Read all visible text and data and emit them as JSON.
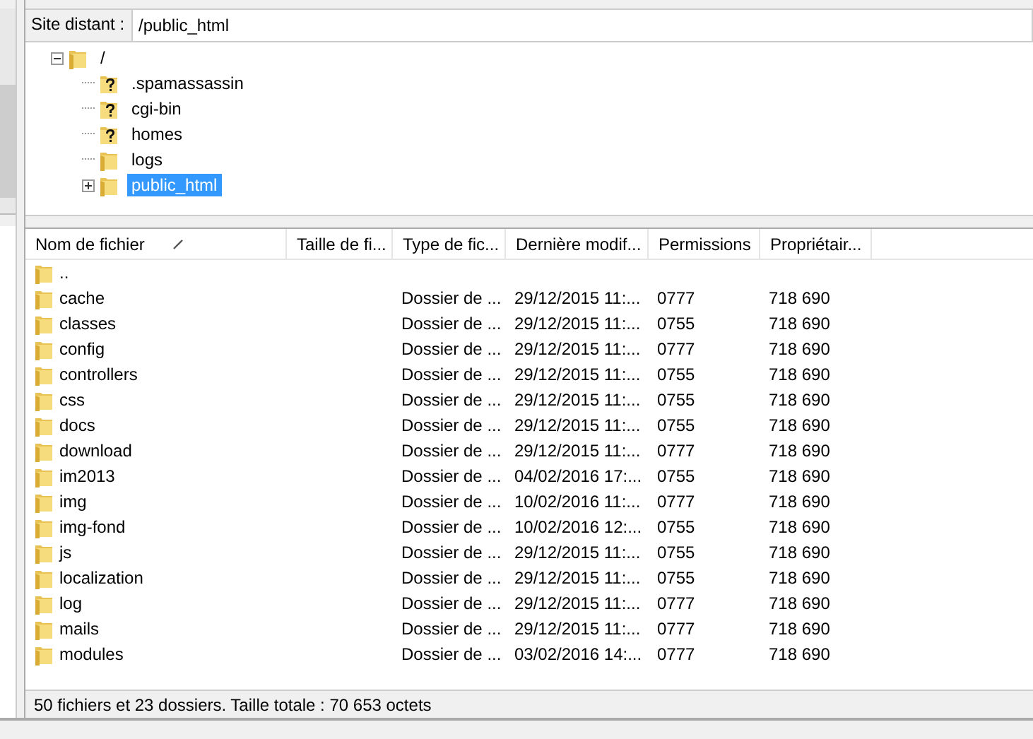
{
  "remote_site": {
    "label": "Site distant :",
    "path": "/public_html"
  },
  "tree": [
    {
      "name": "/",
      "kind": "folder",
      "expanded": true,
      "selected": false,
      "children": [
        {
          "name": ".spamassassin",
          "kind": "unknown",
          "selected": false
        },
        {
          "name": "cgi-bin",
          "kind": "unknown",
          "selected": false
        },
        {
          "name": "homes",
          "kind": "unknown",
          "selected": false
        },
        {
          "name": "logs",
          "kind": "folder",
          "selected": false
        },
        {
          "name": "public_html",
          "kind": "folder",
          "expanded": false,
          "selected": true
        }
      ]
    }
  ],
  "table": {
    "columns": [
      {
        "label": "Nom de fichier",
        "sorted": true
      },
      {
        "label": "Taille de fi...",
        "sorted": false
      },
      {
        "label": "Type de fic...",
        "sorted": false
      },
      {
        "label": "Dernière modif...",
        "sorted": false
      },
      {
        "label": "Permissions",
        "sorted": false
      },
      {
        "label": "Propriétair...",
        "sorted": false
      }
    ],
    "rows": [
      {
        "name": ".."
      },
      {
        "name": "cache",
        "type": "Dossier de ...",
        "modified": "29/12/2015 11:...",
        "permissions": "0777",
        "owner": "718 690"
      },
      {
        "name": "classes",
        "type": "Dossier de ...",
        "modified": "29/12/2015 11:...",
        "permissions": "0755",
        "owner": "718 690"
      },
      {
        "name": "config",
        "type": "Dossier de ...",
        "modified": "29/12/2015 11:...",
        "permissions": "0777",
        "owner": "718 690"
      },
      {
        "name": "controllers",
        "type": "Dossier de ...",
        "modified": "29/12/2015 11:...",
        "permissions": "0755",
        "owner": "718 690"
      },
      {
        "name": "css",
        "type": "Dossier de ...",
        "modified": "29/12/2015 11:...",
        "permissions": "0755",
        "owner": "718 690"
      },
      {
        "name": "docs",
        "type": "Dossier de ...",
        "modified": "29/12/2015 11:...",
        "permissions": "0755",
        "owner": "718 690"
      },
      {
        "name": "download",
        "type": "Dossier de ...",
        "modified": "29/12/2015 11:...",
        "permissions": "0777",
        "owner": "718 690"
      },
      {
        "name": "im2013",
        "type": "Dossier de ...",
        "modified": "04/02/2016 17:...",
        "permissions": "0755",
        "owner": "718 690"
      },
      {
        "name": "img",
        "type": "Dossier de ...",
        "modified": "10/02/2016 11:...",
        "permissions": "0777",
        "owner": "718 690"
      },
      {
        "name": "img-fond",
        "type": "Dossier de ...",
        "modified": "10/02/2016 12:...",
        "permissions": "0755",
        "owner": "718 690"
      },
      {
        "name": "js",
        "type": "Dossier de ...",
        "modified": "29/12/2015 11:...",
        "permissions": "0755",
        "owner": "718 690"
      },
      {
        "name": "localization",
        "type": "Dossier de ...",
        "modified": "29/12/2015 11:...",
        "permissions": "0755",
        "owner": "718 690"
      },
      {
        "name": "log",
        "type": "Dossier de ...",
        "modified": "29/12/2015 11:...",
        "permissions": "0777",
        "owner": "718 690"
      },
      {
        "name": "mails",
        "type": "Dossier de ...",
        "modified": "29/12/2015 11:...",
        "permissions": "0777",
        "owner": "718 690"
      },
      {
        "name": "modules",
        "type": "Dossier de ...",
        "modified": "03/02/2016 14:...",
        "permissions": "0777",
        "owner": "718 690"
      }
    ]
  },
  "status_bar": "50 fichiers et 23 dossiers. Taille totale : 70 653 octets"
}
